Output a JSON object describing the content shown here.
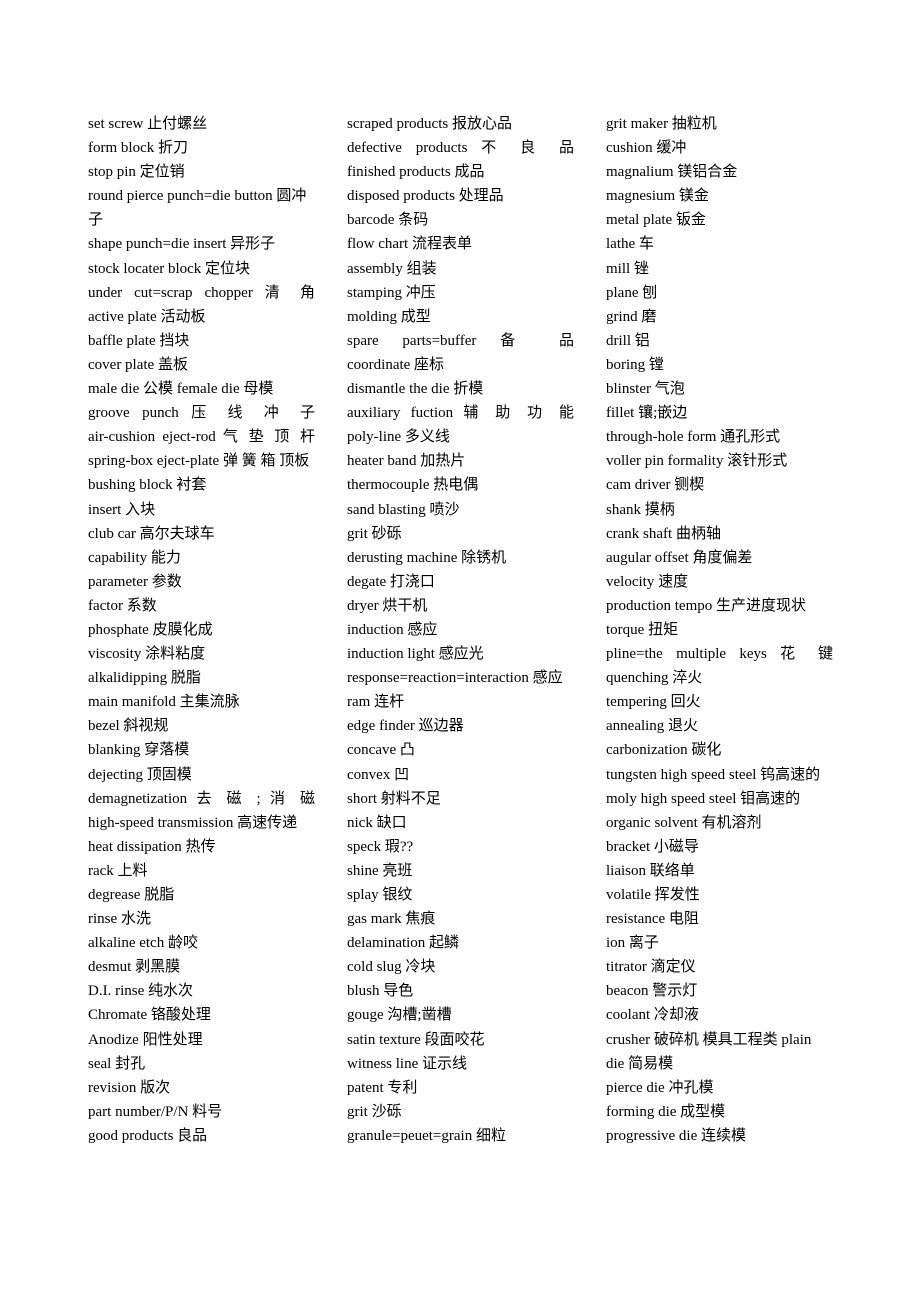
{
  "columns": [
    {
      "entries": [
        "set screw 止付螺丝",
        "form block 折刀",
        "stop pin 定位销",
        "round pierce punch=die button 圆冲子",
        "shape punch=die insert 异形子",
        "stock locater block 定位块",
        "under cut=scrap chopper 清 角",
        "active plate 活动板",
        "baffle plate 挡块",
        "cover plate 盖板",
        "male die 公模  female die 母模",
        "groove punch 压 线 冲 子",
        "air-cushion eject-rod 气 垫 顶 杆",
        "spring-box eject-plate 弹 簧 箱 顶板",
        "bushing block 衬套",
        "insert  入块",
        "club car 高尔夫球车",
        "capability 能力",
        "parameter 参数",
        "factor 系数",
        "phosphate 皮膜化成",
        "viscosity 涂料粘度",
        "alkalidipping 脱脂",
        "main manifold 主集流脉",
        "bezel 斜视规",
        "blanking 穿落模",
        "dejecting 顶固模",
        "demagnetization 去 磁 ; 消 磁",
        "high-speed transmission 高速传递",
        "heat dissipation 热传",
        "rack 上料",
        "degrease 脱脂",
        "rinse 水洗",
        "alkaline etch 龄咬",
        "desmut 剥黑膜",
        "D.I. rinse 纯水次",
        "Chromate 铬酸处理",
        "Anodize 阳性处理",
        "seal 封孔",
        "revision 版次",
        "part number/P/N 料号",
        "good products 良品"
      ]
    },
    {
      "entries": [
        "scraped products 报放心品",
        "defective products 不 良 品",
        "finished products 成品",
        "disposed products 处理品",
        "barcode 条码",
        "flow chart 流程表单",
        "assembly 组装",
        "stamping 冲压",
        "molding 成型",
        "spare parts=buffer 备 品",
        "coordinate 座标",
        "dismantle the die 折模",
        "auxiliary fuction 辅 助 功 能",
        "poly-line 多义线",
        "heater band  加热片",
        "thermocouple 热电偶",
        "sand blasting 喷沙",
        "grit  砂砾",
        "derusting machine 除锈机",
        "degate 打浇口",
        "dryer 烘干机",
        "induction 感应",
        "induction light 感应光",
        "response=reaction=interaction  感应",
        "ram 连杆",
        "edge finder 巡边器",
        "concave 凸",
        "convex 凹",
        "short 射料不足",
        "nick 缺口",
        "speck 瑕??",
        "shine 亮班",
        "splay  银纹",
        "gas mark 焦痕",
        "delamination 起鳞",
        "cold slug 冷块",
        "blush  导色",
        "gouge 沟槽;凿槽",
        "satin texture 段面咬花",
        "witness line 证示线",
        "patent 专利",
        "grit 沙砾",
        "granule=peuet=grain 细粒"
      ]
    },
    {
      "entries": [
        "grit maker 抽粒机",
        "cushion 缓冲",
        "magnalium 镁铝合金",
        "magnesium 镁金",
        "metal plate 钣金",
        "lathe 车",
        "mill 锉",
        "plane 刨",
        "grind 磨",
        "drill 铝",
        "boring 镗",
        "blinster 气泡",
        "fillet 镶;嵌边",
        "through-hole form 通孔形式",
        "voller pin formality 滚针形式",
        "cam driver 铡楔",
        "shank 摸柄",
        "crank shaft 曲柄轴",
        "augular offset 角度偏差",
        "velocity 速度",
        "production tempo 生产进度现状",
        "torque 扭矩",
        "pline=the multiple keys 花 键",
        "quenching 淬火",
        "tempering 回火",
        "annealing 退火",
        "carbonization 碳化",
        "tungsten high speed steel 钨高速的",
        "moly high speed steel 钼高速的",
        "organic solvent 有机溶剂",
        "bracket 小磁导",
        "liaison 联络单",
        "volatile 挥发性",
        "resistance 电阻",
        "ion 离子",
        "titrator 滴定仪",
        "beacon 警示灯",
        "coolant 冷却液",
        "crusher 破碎机  模具工程类  plain die 简易模",
        "pierce die 冲孔模",
        "forming die 成型模",
        "progressive die 连续模"
      ]
    }
  ]
}
